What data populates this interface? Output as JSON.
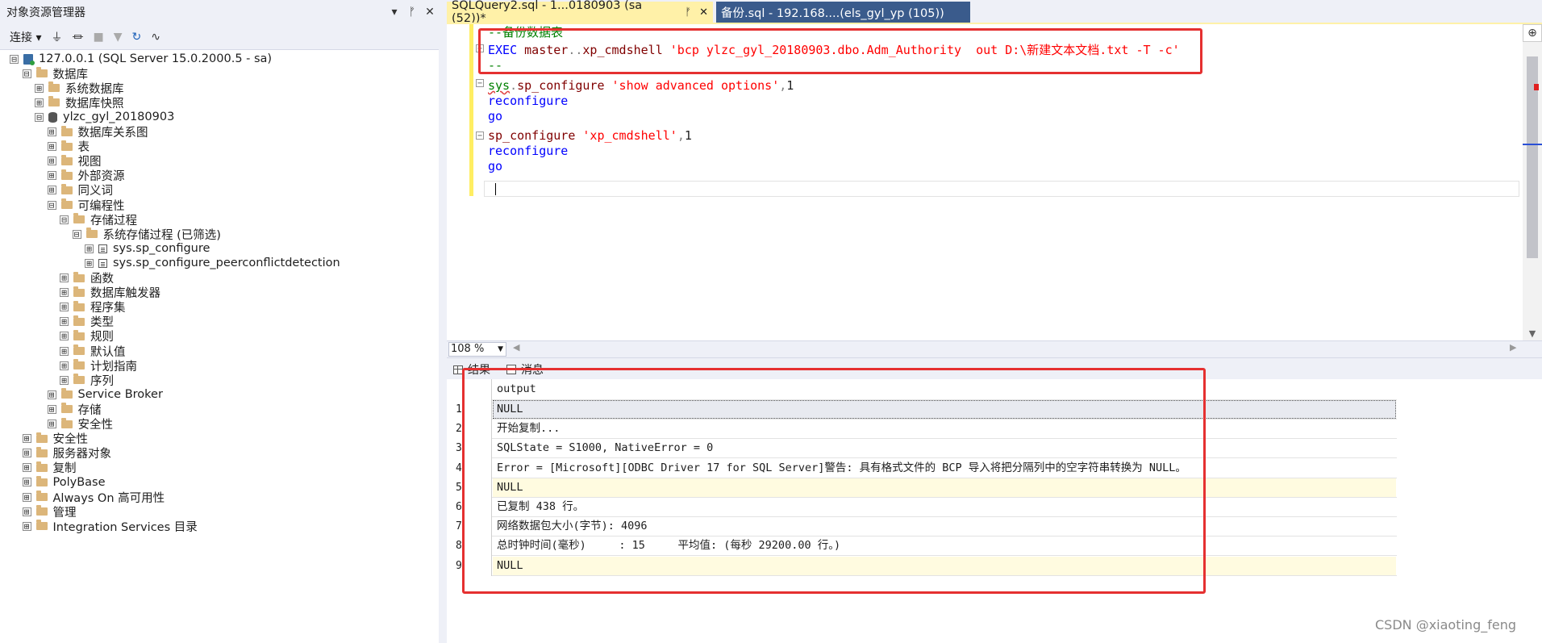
{
  "object_explorer": {
    "title": "对象资源管理器",
    "title_buttons": [
      "▾",
      "ᚠ",
      "✕"
    ],
    "connect_label": "连接 ▾",
    "tree": [
      {
        "label": "127.0.0.1 (SQL Server 15.0.2000.5 - sa)",
        "expander": "⊟",
        "icon": "server-icon",
        "level": 0
      },
      {
        "label": "数据库",
        "expander": "⊟",
        "icon": "folder-icon",
        "level": 1
      },
      {
        "label": "系统数据库",
        "expander": "⊞",
        "icon": "folder-icon",
        "level": 2
      },
      {
        "label": "数据库快照",
        "expander": "⊞",
        "icon": "folder-icon",
        "level": 2
      },
      {
        "label": "ylzc_gyl_20180903",
        "expander": "⊟",
        "icon": "database-icon",
        "level": 2
      },
      {
        "label": "数据库关系图",
        "expander": "⊞",
        "icon": "folder-icon",
        "level": 3
      },
      {
        "label": "表",
        "expander": "⊞",
        "icon": "folder-icon",
        "level": 3
      },
      {
        "label": "视图",
        "expander": "⊞",
        "icon": "folder-icon",
        "level": 3
      },
      {
        "label": "外部资源",
        "expander": "⊞",
        "icon": "folder-icon",
        "level": 3
      },
      {
        "label": "同义词",
        "expander": "⊞",
        "icon": "folder-icon",
        "level": 3
      },
      {
        "label": "可编程性",
        "expander": "⊟",
        "icon": "folder-icon",
        "level": 3
      },
      {
        "label": "存储过程",
        "expander": "⊟",
        "icon": "folder-icon",
        "level": 4
      },
      {
        "label": "系统存储过程 (已筛选)",
        "expander": "⊟",
        "icon": "folder-icon",
        "level": 5
      },
      {
        "label": "sys.sp_configure",
        "expander": "⊞",
        "icon": "procedure-icon",
        "level": 6
      },
      {
        "label": "sys.sp_configure_peerconflictdetection",
        "expander": "⊞",
        "icon": "procedure-icon",
        "level": 6
      },
      {
        "label": "函数",
        "expander": "⊞",
        "icon": "folder-icon",
        "level": 4
      },
      {
        "label": "数据库触发器",
        "expander": "⊞",
        "icon": "folder-icon",
        "level": 4
      },
      {
        "label": "程序集",
        "expander": "⊞",
        "icon": "folder-icon",
        "level": 4
      },
      {
        "label": "类型",
        "expander": "⊞",
        "icon": "folder-icon",
        "level": 4
      },
      {
        "label": "规则",
        "expander": "⊞",
        "icon": "folder-icon",
        "level": 4
      },
      {
        "label": "默认值",
        "expander": "⊞",
        "icon": "folder-icon",
        "level": 4
      },
      {
        "label": "计划指南",
        "expander": "⊞",
        "icon": "folder-icon",
        "level": 4
      },
      {
        "label": "序列",
        "expander": "⊞",
        "icon": "folder-icon",
        "level": 4
      },
      {
        "label": "Service Broker",
        "expander": "⊞",
        "icon": "folder-icon",
        "level": 3
      },
      {
        "label": "存储",
        "expander": "⊞",
        "icon": "folder-icon",
        "level": 3
      },
      {
        "label": "安全性",
        "expander": "⊞",
        "icon": "folder-icon",
        "level": 3
      },
      {
        "label": "安全性",
        "expander": "⊞",
        "icon": "folder-icon",
        "level": 1
      },
      {
        "label": "服务器对象",
        "expander": "⊞",
        "icon": "folder-icon",
        "level": 1
      },
      {
        "label": "复制",
        "expander": "⊞",
        "icon": "folder-icon",
        "level": 1
      },
      {
        "label": "PolyBase",
        "expander": "⊞",
        "icon": "folder-icon",
        "level": 1
      },
      {
        "label": "Always On 高可用性",
        "expander": "⊞",
        "icon": "folder-icon",
        "level": 1
      },
      {
        "label": "管理",
        "expander": "⊞",
        "icon": "folder-icon",
        "level": 1
      },
      {
        "label": "Integration Services 目录",
        "expander": "⊞",
        "icon": "folder-icon",
        "level": 1
      }
    ]
  },
  "tabs": [
    {
      "label": "SQLQuery2.sql - 1...0180903 (sa (52))*",
      "pin": "ᚠ",
      "close": "✕"
    },
    {
      "label": "备份.sql - 192.168....(els_gyl_yp (105))"
    }
  ],
  "editor": {
    "lines": [
      {
        "segments": [
          {
            "t": "--备份数据表",
            "c": "cm"
          }
        ]
      },
      {
        "segments": [
          {
            "t": "EXEC ",
            "c": "kw"
          },
          {
            "t": "master",
            "c": "fn"
          },
          {
            "t": "..",
            "c": "gr"
          },
          {
            "t": "xp_cmdshell ",
            "c": "fn"
          },
          {
            "t": "'bcp ylzc_gyl_20180903.dbo.Adm_Authority  out D:\\新建文本文档.txt -T -c'",
            "c": "str"
          }
        ]
      },
      {
        "segments": [
          {
            "t": "--",
            "c": "cm"
          }
        ]
      },
      {
        "segments": [
          {
            "t": "sys",
            "c": "sq"
          },
          {
            "t": ".",
            "c": "gr"
          },
          {
            "t": "sp_configure ",
            "c": "fn"
          },
          {
            "t": "'show advanced options'",
            "c": "str"
          },
          {
            "t": ",",
            "c": "gr"
          },
          {
            "t": "1",
            "c": ""
          }
        ]
      },
      {
        "segments": [
          {
            "t": "reconfigure",
            "c": "kw"
          }
        ]
      },
      {
        "segments": [
          {
            "t": "go",
            "c": "kw"
          }
        ]
      },
      {
        "segments": [
          {
            "t": "sp_configure ",
            "c": "fn"
          },
          {
            "t": "'xp_cmdshell'",
            "c": "str"
          },
          {
            "t": ",",
            "c": "gr"
          },
          {
            "t": "1",
            "c": ""
          }
        ]
      },
      {
        "segments": [
          {
            "t": "reconfigure",
            "c": "kw"
          }
        ]
      },
      {
        "segments": [
          {
            "t": "go",
            "c": "kw"
          }
        ]
      }
    ]
  },
  "zoom": "108 %",
  "result_tabs": {
    "results": "结果",
    "messages": "消息"
  },
  "results": {
    "column": "output",
    "rows": [
      "NULL",
      "开始复制...",
      "SQLState = S1000, NativeError = 0",
      "Error = [Microsoft][ODBC Driver 17 for SQL Server]警告: 具有格式文件的 BCP 导入将把分隔列中的空字符串转换为 NULL。",
      "NULL",
      "已复制 438 行。",
      "网络数据包大小(字节): 4096",
      "总时钟时间(毫秒)     : 15     平均值: (每秒 29200.00 行。)",
      "NULL"
    ],
    "row_numbers": [
      "1",
      "2",
      "3",
      "4",
      "5",
      "6",
      "7",
      "8",
      "9"
    ]
  },
  "watermark": "CSDN @xiaoting_feng"
}
